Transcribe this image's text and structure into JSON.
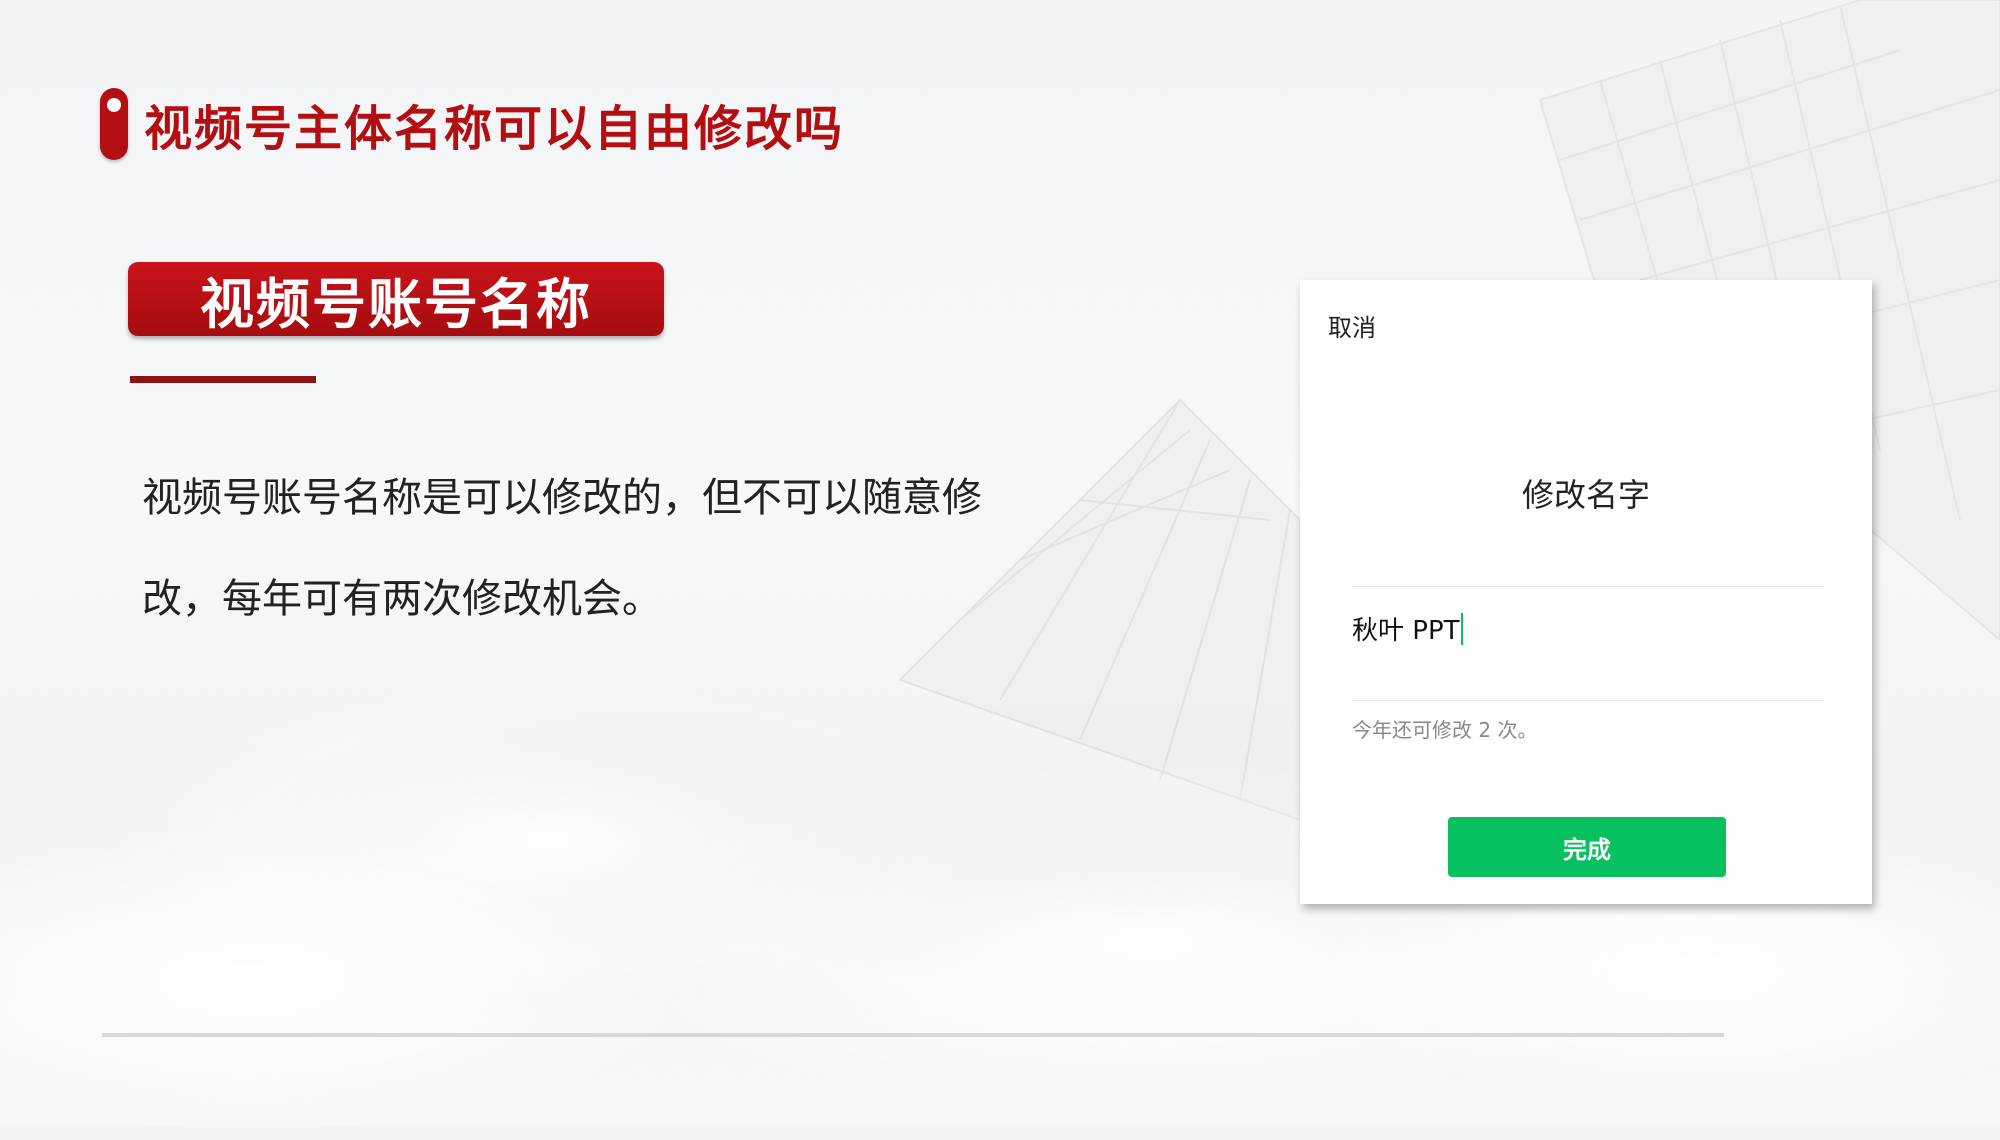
{
  "slide": {
    "title": "视频号主体名称可以自由修改吗",
    "section_label": "视频号账号名称",
    "body_line1": "视频号账号名称是可以修改的，但不可以随意修",
    "body_line2": "改，每年可有两次修改机会。"
  },
  "dialog": {
    "cancel_label": "取消",
    "title": "修改名字",
    "name_value": "秋叶 PPT",
    "hint": "今年还可修改 2 次。",
    "done_label": "完成"
  },
  "colors": {
    "accent_red": "#b30f12",
    "wechat_green": "#07c160"
  }
}
